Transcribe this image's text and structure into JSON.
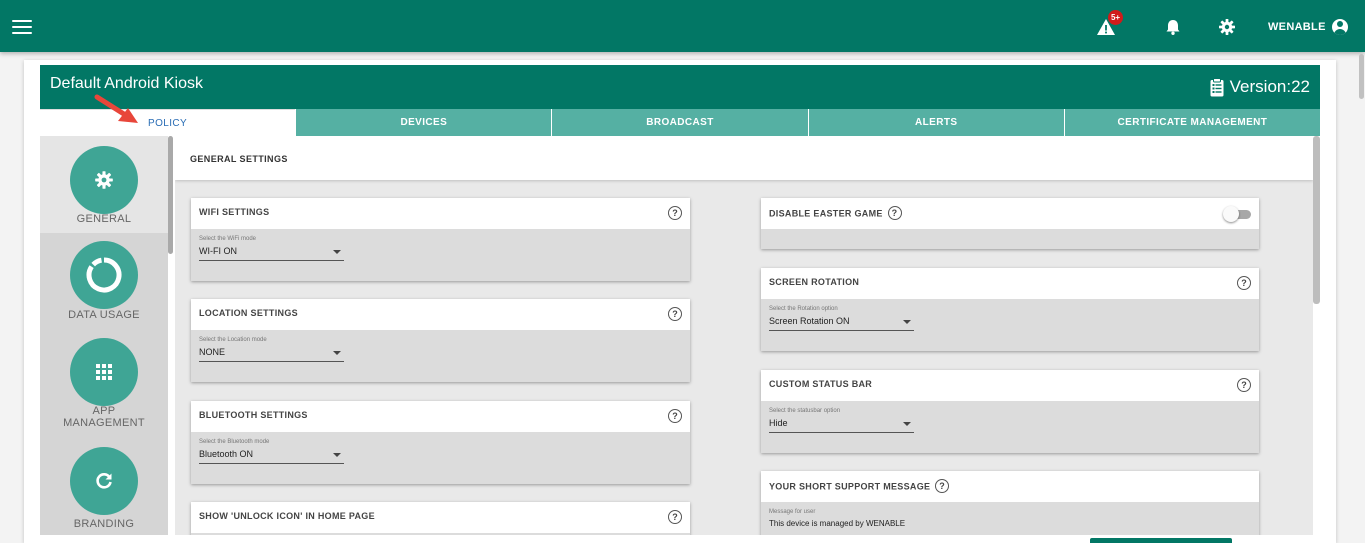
{
  "topbar": {
    "alert_badge": "5+",
    "user_name": "WENABLE"
  },
  "header": {
    "title": "Default Android Kiosk",
    "version": "Version:22"
  },
  "tabs": [
    {
      "label": "POLICY"
    },
    {
      "label": "DEVICES"
    },
    {
      "label": "BROADCAST"
    },
    {
      "label": "ALERTS"
    },
    {
      "label": "CERTIFICATE MANAGEMENT"
    }
  ],
  "sidebar": {
    "items": [
      {
        "label": "GENERAL",
        "icon": "gear-icon"
      },
      {
        "label": "DATA USAGE",
        "icon": "donut-icon"
      },
      {
        "label": "APP MANAGEMENT",
        "icon": "grid-icon"
      },
      {
        "label": "BRANDING",
        "icon": "refresh-icon"
      }
    ]
  },
  "section": {
    "title": "GENERAL SETTINGS"
  },
  "help_glyph": "?",
  "panels": {
    "wifi": {
      "title": "WIFI SETTINGS",
      "hint": "Select the WiFi mode",
      "value": "WI-FI ON"
    },
    "location": {
      "title": "LOCATION SETTINGS",
      "hint": "Select the Location mode",
      "value": "NONE"
    },
    "bluetooth": {
      "title": "BLUETOOTH SETTINGS",
      "hint": "Select the Bluetooth mode",
      "value": "Bluetooth ON"
    },
    "unlock": {
      "title": "SHOW 'UNLOCK ICON' IN HOME PAGE"
    },
    "easter": {
      "title": "DISABLE EASTER GAME",
      "enabled": false
    },
    "rotation": {
      "title": "SCREEN ROTATION",
      "hint": "Select the Rotation option",
      "value": "Screen Rotation ON"
    },
    "statusbar": {
      "title": "CUSTOM STATUS BAR",
      "hint": "Select the statusbar option",
      "value": "Hide"
    },
    "support": {
      "title": "YOUR SHORT SUPPORT MESSAGE",
      "hint": "Message for user",
      "value": "This device is managed by WENABLE"
    }
  },
  "colors": {
    "primary": "#027765",
    "tab": "#55b0a3",
    "sidebar_circle": "#3fa595",
    "badge": "#d11b1b"
  }
}
